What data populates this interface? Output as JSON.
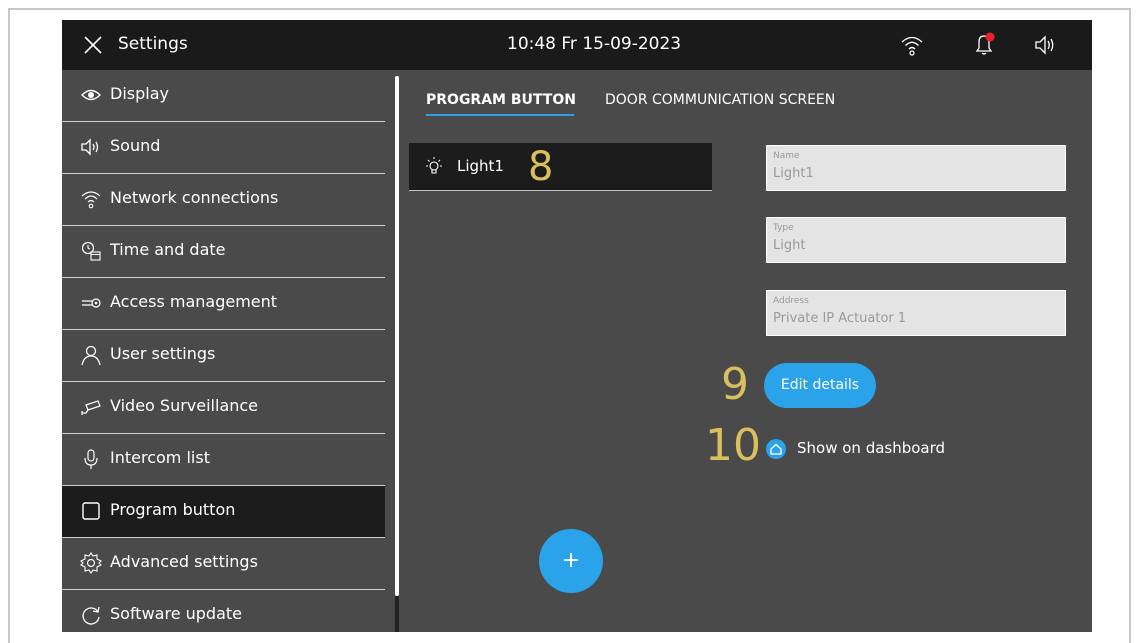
{
  "header": {
    "title": "Settings",
    "clock": "10:48  Fr 15-09-2023",
    "icons": [
      "close-icon",
      "wifi-icon",
      "bell-icon",
      "speaker-icon"
    ],
    "notification_dot_color": "#e8232b"
  },
  "sidebar": {
    "items": [
      {
        "label": "Display",
        "icon": "eye-icon"
      },
      {
        "label": "Sound",
        "icon": "speaker-icon"
      },
      {
        "label": "Network connections",
        "icon": "wifi-icon"
      },
      {
        "label": "Time and date",
        "icon": "clock-calendar-icon"
      },
      {
        "label": "Access  management",
        "icon": "key-icon"
      },
      {
        "label": "User settings",
        "icon": "user-icon"
      },
      {
        "label": "Video Surveillance",
        "icon": "camera-icon"
      },
      {
        "label": "Intercom list",
        "icon": "microphone-icon"
      },
      {
        "label": "Program button",
        "icon": "square-icon",
        "active": true
      },
      {
        "label": "Advanced settings",
        "icon": "gear-icon"
      },
      {
        "label": "Software update",
        "icon": "refresh-icon"
      }
    ]
  },
  "tabs": [
    {
      "label": "PROGRAM BUTTON",
      "active": true
    },
    {
      "label": "DOOR COMMUNICATION SCREEN",
      "active": false
    }
  ],
  "list": {
    "items": [
      {
        "label": "Light1",
        "icon": "bulb-icon"
      }
    ]
  },
  "annotations": {
    "a8": "8",
    "a9": "9",
    "a10": "10"
  },
  "details": {
    "name": {
      "label": "Name",
      "value": "Light1"
    },
    "type": {
      "label": "Type",
      "value": "Light"
    },
    "address": {
      "label": "Address",
      "value": "Private IP Actuator 1"
    },
    "edit_button": "Edit details",
    "show_on_dashboard": "Show on dashboard"
  },
  "fab_label": "+",
  "colors": {
    "accent": "#2aa3eb",
    "header_bg": "#1a1a1a",
    "panel_bg": "#4a4a4a",
    "annotation": "#d9c05d"
  }
}
